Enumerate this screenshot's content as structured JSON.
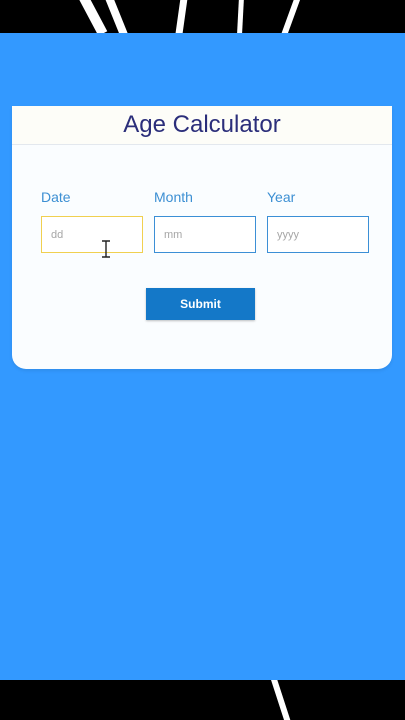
{
  "card": {
    "title": "Age Calculator"
  },
  "fields": {
    "date": {
      "label": "Date",
      "placeholder": "dd"
    },
    "month": {
      "label": "Month",
      "placeholder": "mm"
    },
    "year": {
      "label": "Year",
      "placeholder": "yyyy"
    }
  },
  "submit_label": "Submit",
  "colors": {
    "background": "#3399ff",
    "button": "#1478c8",
    "title": "#2b2e7a",
    "focus_border": "#f0d050"
  },
  "cursor_icon": "text-cursor-icon"
}
